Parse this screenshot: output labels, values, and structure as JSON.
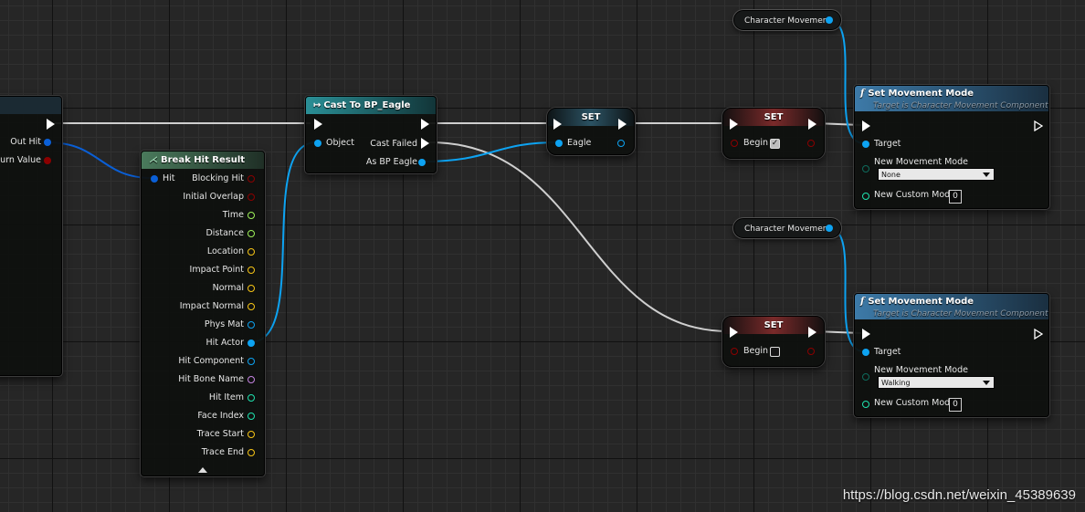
{
  "colors": {
    "exec": "#ffffff",
    "object_pin": "#0da3f2",
    "struct_pin": "#0a5fd6",
    "bool_pin": "#8b0000",
    "float_pin": "#9ef15a",
    "vector_pin": "#f7c516",
    "name_pin": "#c583e2",
    "int_pin": "#1fe3af",
    "cast_header": "#1d6e78",
    "function_header": "#2d5f82",
    "set_header": "#6b2020",
    "break_header": "#375a46"
  },
  "left_node": {
    "out_hit": "Out Hit",
    "return_value": "eturn Value"
  },
  "break_hit_result": {
    "title": "Break Hit Result",
    "input_hit": "Hit",
    "outputs": [
      "Blocking Hit",
      "Initial Overlap",
      "Time",
      "Distance",
      "Location",
      "Impact Point",
      "Normal",
      "Impact Normal",
      "Phys Mat",
      "Hit Actor",
      "Hit Component",
      "Hit Bone Name",
      "Hit Item",
      "Face Index",
      "Trace Start",
      "Trace End"
    ],
    "output_types": [
      "bool",
      "bool",
      "float",
      "float",
      "vector",
      "vector",
      "vector",
      "vector",
      "object",
      "object",
      "object",
      "name",
      "int",
      "int",
      "vector",
      "vector"
    ]
  },
  "cast_node": {
    "title": "Cast To BP_Eagle",
    "icon": "cast-arrow-icon",
    "object_pin": "Object",
    "cast_failed": "Cast Failed",
    "as_bp_eagle": "As BP Eagle"
  },
  "set_eagle": {
    "title": "SET",
    "pin": "Eagle"
  },
  "set_begin_true": {
    "title": "SET",
    "pin": "Begin",
    "checked": true
  },
  "set_begin_false": {
    "title": "SET",
    "pin": "Begin",
    "checked": false
  },
  "char_move_1": {
    "label": "Character Movement"
  },
  "char_move_2": {
    "label": "Character Movement"
  },
  "set_move_mode_1": {
    "title": "Set Movement Mode",
    "subtitle": "Target is Character Movement Component",
    "target": "Target",
    "new_mode_label": "New Movement Mode",
    "new_mode_value": "None",
    "custom_mode_label": "New Custom Mode",
    "custom_mode_value": "0"
  },
  "set_move_mode_2": {
    "title": "Set Movement Mode",
    "subtitle": "Target is Character Movement Component",
    "target": "Target",
    "new_mode_label": "New Movement Mode",
    "new_mode_value": "Walking",
    "custom_mode_label": "New Custom Mode",
    "custom_mode_value": "0"
  },
  "watermark": "https://blog.csdn.net/weixin_45389639"
}
